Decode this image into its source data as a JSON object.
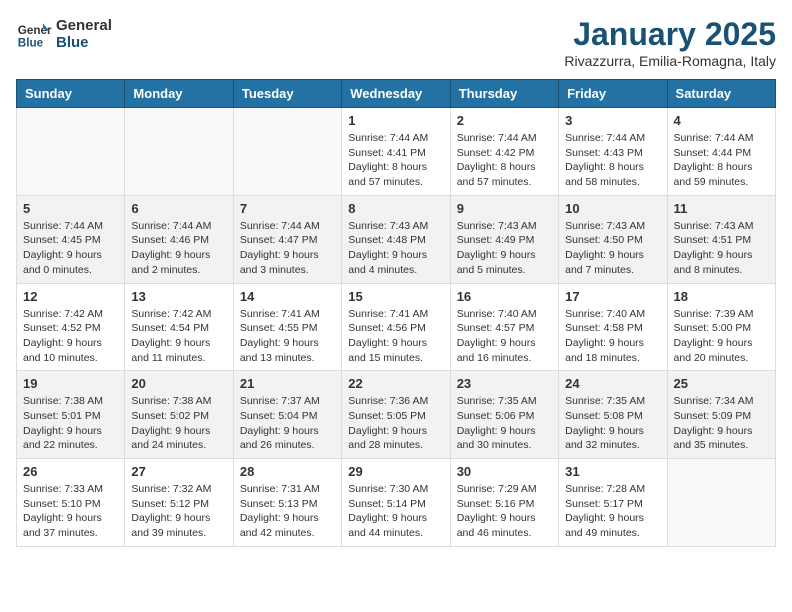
{
  "logo": {
    "general": "General",
    "blue": "Blue"
  },
  "title": "January 2025",
  "subtitle": "Rivazzurra, Emilia-Romagna, Italy",
  "days_of_week": [
    "Sunday",
    "Monday",
    "Tuesday",
    "Wednesday",
    "Thursday",
    "Friday",
    "Saturday"
  ],
  "weeks": [
    [
      {
        "day": "",
        "info": ""
      },
      {
        "day": "",
        "info": ""
      },
      {
        "day": "",
        "info": ""
      },
      {
        "day": "1",
        "info": "Sunrise: 7:44 AM\nSunset: 4:41 PM\nDaylight: 8 hours\nand 57 minutes."
      },
      {
        "day": "2",
        "info": "Sunrise: 7:44 AM\nSunset: 4:42 PM\nDaylight: 8 hours\nand 57 minutes."
      },
      {
        "day": "3",
        "info": "Sunrise: 7:44 AM\nSunset: 4:43 PM\nDaylight: 8 hours\nand 58 minutes."
      },
      {
        "day": "4",
        "info": "Sunrise: 7:44 AM\nSunset: 4:44 PM\nDaylight: 8 hours\nand 59 minutes."
      }
    ],
    [
      {
        "day": "5",
        "info": "Sunrise: 7:44 AM\nSunset: 4:45 PM\nDaylight: 9 hours\nand 0 minutes."
      },
      {
        "day": "6",
        "info": "Sunrise: 7:44 AM\nSunset: 4:46 PM\nDaylight: 9 hours\nand 2 minutes."
      },
      {
        "day": "7",
        "info": "Sunrise: 7:44 AM\nSunset: 4:47 PM\nDaylight: 9 hours\nand 3 minutes."
      },
      {
        "day": "8",
        "info": "Sunrise: 7:43 AM\nSunset: 4:48 PM\nDaylight: 9 hours\nand 4 minutes."
      },
      {
        "day": "9",
        "info": "Sunrise: 7:43 AM\nSunset: 4:49 PM\nDaylight: 9 hours\nand 5 minutes."
      },
      {
        "day": "10",
        "info": "Sunrise: 7:43 AM\nSunset: 4:50 PM\nDaylight: 9 hours\nand 7 minutes."
      },
      {
        "day": "11",
        "info": "Sunrise: 7:43 AM\nSunset: 4:51 PM\nDaylight: 9 hours\nand 8 minutes."
      }
    ],
    [
      {
        "day": "12",
        "info": "Sunrise: 7:42 AM\nSunset: 4:52 PM\nDaylight: 9 hours\nand 10 minutes."
      },
      {
        "day": "13",
        "info": "Sunrise: 7:42 AM\nSunset: 4:54 PM\nDaylight: 9 hours\nand 11 minutes."
      },
      {
        "day": "14",
        "info": "Sunrise: 7:41 AM\nSunset: 4:55 PM\nDaylight: 9 hours\nand 13 minutes."
      },
      {
        "day": "15",
        "info": "Sunrise: 7:41 AM\nSunset: 4:56 PM\nDaylight: 9 hours\nand 15 minutes."
      },
      {
        "day": "16",
        "info": "Sunrise: 7:40 AM\nSunset: 4:57 PM\nDaylight: 9 hours\nand 16 minutes."
      },
      {
        "day": "17",
        "info": "Sunrise: 7:40 AM\nSunset: 4:58 PM\nDaylight: 9 hours\nand 18 minutes."
      },
      {
        "day": "18",
        "info": "Sunrise: 7:39 AM\nSunset: 5:00 PM\nDaylight: 9 hours\nand 20 minutes."
      }
    ],
    [
      {
        "day": "19",
        "info": "Sunrise: 7:38 AM\nSunset: 5:01 PM\nDaylight: 9 hours\nand 22 minutes."
      },
      {
        "day": "20",
        "info": "Sunrise: 7:38 AM\nSunset: 5:02 PM\nDaylight: 9 hours\nand 24 minutes."
      },
      {
        "day": "21",
        "info": "Sunrise: 7:37 AM\nSunset: 5:04 PM\nDaylight: 9 hours\nand 26 minutes."
      },
      {
        "day": "22",
        "info": "Sunrise: 7:36 AM\nSunset: 5:05 PM\nDaylight: 9 hours\nand 28 minutes."
      },
      {
        "day": "23",
        "info": "Sunrise: 7:35 AM\nSunset: 5:06 PM\nDaylight: 9 hours\nand 30 minutes."
      },
      {
        "day": "24",
        "info": "Sunrise: 7:35 AM\nSunset: 5:08 PM\nDaylight: 9 hours\nand 32 minutes."
      },
      {
        "day": "25",
        "info": "Sunrise: 7:34 AM\nSunset: 5:09 PM\nDaylight: 9 hours\nand 35 minutes."
      }
    ],
    [
      {
        "day": "26",
        "info": "Sunrise: 7:33 AM\nSunset: 5:10 PM\nDaylight: 9 hours\nand 37 minutes."
      },
      {
        "day": "27",
        "info": "Sunrise: 7:32 AM\nSunset: 5:12 PM\nDaylight: 9 hours\nand 39 minutes."
      },
      {
        "day": "28",
        "info": "Sunrise: 7:31 AM\nSunset: 5:13 PM\nDaylight: 9 hours\nand 42 minutes."
      },
      {
        "day": "29",
        "info": "Sunrise: 7:30 AM\nSunset: 5:14 PM\nDaylight: 9 hours\nand 44 minutes."
      },
      {
        "day": "30",
        "info": "Sunrise: 7:29 AM\nSunset: 5:16 PM\nDaylight: 9 hours\nand 46 minutes."
      },
      {
        "day": "31",
        "info": "Sunrise: 7:28 AM\nSunset: 5:17 PM\nDaylight: 9 hours\nand 49 minutes."
      },
      {
        "day": "",
        "info": ""
      }
    ]
  ]
}
